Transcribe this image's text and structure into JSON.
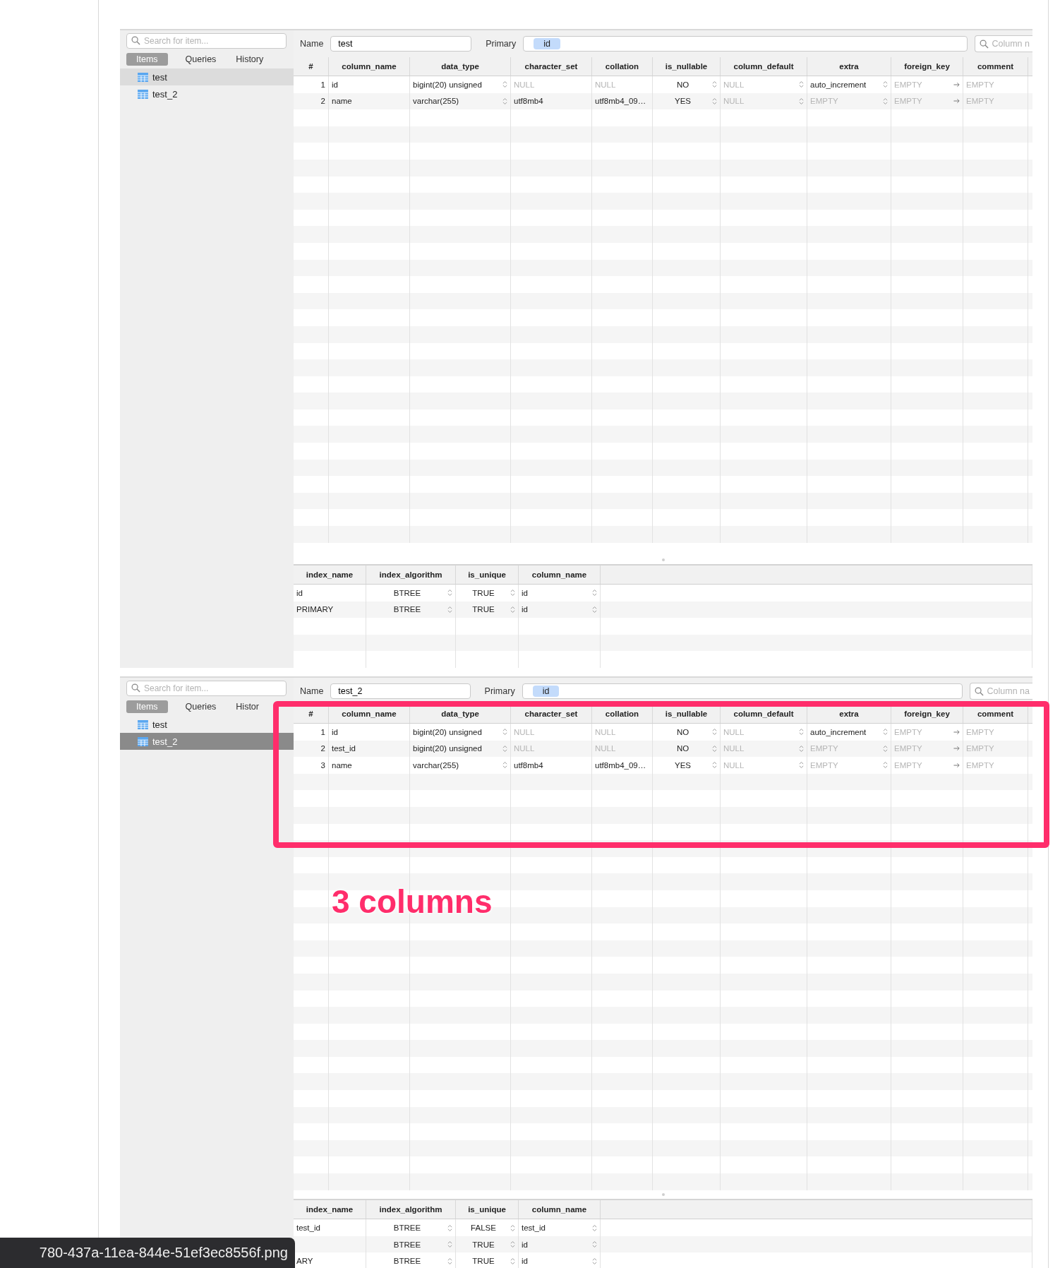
{
  "panels": [
    {
      "active": false,
      "search": {
        "placeholder": "Search for item..."
      },
      "tabs": [
        {
          "label": "Items",
          "selected": true
        },
        {
          "label": "Queries",
          "selected": false
        },
        {
          "label": "History",
          "selected": false
        }
      ],
      "items": [
        {
          "label": "test",
          "selected": true
        },
        {
          "label": "test_2",
          "selected": false
        }
      ],
      "name_label": "Name",
      "name_value": "test",
      "primary_label": "Primary",
      "primary_keys": [
        "id"
      ],
      "column_search": {
        "placeholder": "Column n"
      },
      "columns": [
        {
          "label": "#",
          "kind": "index"
        },
        {
          "label": "column_name",
          "kind": "text"
        },
        {
          "label": "data_type",
          "kind": "select"
        },
        {
          "label": "character_set",
          "kind": "text"
        },
        {
          "label": "collation",
          "kind": "text"
        },
        {
          "label": "is_nullable",
          "kind": "centered-select"
        },
        {
          "label": "column_default",
          "kind": "select"
        },
        {
          "label": "extra",
          "kind": "select"
        },
        {
          "label": "foreign_key",
          "kind": "reference"
        },
        {
          "label": "comment",
          "kind": "text"
        }
      ],
      "rows": [
        {
          "cells": [
            {
              "text": "1",
              "muted": false
            },
            {
              "text": "id",
              "muted": false
            },
            {
              "text": "bigint(20) unsigned",
              "muted": false
            },
            {
              "text": "NULL",
              "muted": true
            },
            {
              "text": "NULL",
              "muted": true
            },
            {
              "text": "NO",
              "muted": false
            },
            {
              "text": "NULL",
              "muted": true
            },
            {
              "text": "auto_increment",
              "muted": false
            },
            {
              "text": "EMPTY",
              "muted": true
            },
            {
              "text": "EMPTY",
              "muted": true
            }
          ]
        },
        {
          "cells": [
            {
              "text": "2",
              "muted": false
            },
            {
              "text": "name",
              "muted": false
            },
            {
              "text": "varchar(255)",
              "muted": false
            },
            {
              "text": "utf8mb4",
              "muted": false
            },
            {
              "text": "utf8mb4_09…",
              "muted": false
            },
            {
              "text": "YES",
              "muted": false
            },
            {
              "text": "NULL",
              "muted": true
            },
            {
              "text": "EMPTY",
              "muted": true
            },
            {
              "text": "EMPTY",
              "muted": true
            },
            {
              "text": "EMPTY",
              "muted": true
            }
          ]
        }
      ],
      "index_columns": [
        {
          "label": "index_name",
          "kind": "text"
        },
        {
          "label": "index_algorithm",
          "kind": "centered-select"
        },
        {
          "label": "is_unique",
          "kind": "centered-select"
        },
        {
          "label": "column_name",
          "kind": "select"
        }
      ],
      "index_rows": [
        {
          "cells": [
            {
              "text": "id",
              "muted": false
            },
            {
              "text": "BTREE",
              "muted": false
            },
            {
              "text": "TRUE",
              "muted": false
            },
            {
              "text": "id",
              "muted": false
            }
          ]
        },
        {
          "cells": [
            {
              "text": "PRIMARY",
              "muted": false
            },
            {
              "text": "BTREE",
              "muted": false
            },
            {
              "text": "TRUE",
              "muted": false
            },
            {
              "text": "id",
              "muted": false
            }
          ]
        }
      ]
    },
    {
      "active": true,
      "search": {
        "placeholder": "Search for item..."
      },
      "tabs": [
        {
          "label": "Items",
          "selected": true
        },
        {
          "label": "Queries",
          "selected": false
        },
        {
          "label": "Histor",
          "selected": false
        }
      ],
      "items": [
        {
          "label": "test",
          "selected": false
        },
        {
          "label": "test_2",
          "selected": true
        }
      ],
      "name_label": "Name",
      "name_value": "test_2",
      "primary_label": "Primary",
      "primary_keys": [
        "id"
      ],
      "column_search": {
        "placeholder": "Column na"
      },
      "columns": [
        {
          "label": "#",
          "kind": "index"
        },
        {
          "label": "column_name",
          "kind": "text"
        },
        {
          "label": "data_type",
          "kind": "select"
        },
        {
          "label": "character_set",
          "kind": "text"
        },
        {
          "label": "collation",
          "kind": "text"
        },
        {
          "label": "is_nullable",
          "kind": "centered-select"
        },
        {
          "label": "column_default",
          "kind": "select"
        },
        {
          "label": "extra",
          "kind": "select"
        },
        {
          "label": "foreign_key",
          "kind": "reference"
        },
        {
          "label": "comment",
          "kind": "text"
        }
      ],
      "rows": [
        {
          "cells": [
            {
              "text": "1",
              "muted": false
            },
            {
              "text": "id",
              "muted": false
            },
            {
              "text": "bigint(20) unsigned",
              "muted": false
            },
            {
              "text": "NULL",
              "muted": true
            },
            {
              "text": "NULL",
              "muted": true
            },
            {
              "text": "NO",
              "muted": false
            },
            {
              "text": "NULL",
              "muted": true
            },
            {
              "text": "auto_increment",
              "muted": false
            },
            {
              "text": "EMPTY",
              "muted": true
            },
            {
              "text": "EMPTY",
              "muted": true
            }
          ]
        },
        {
          "cells": [
            {
              "text": "2",
              "muted": false
            },
            {
              "text": "test_id",
              "muted": false
            },
            {
              "text": "bigint(20) unsigned",
              "muted": false
            },
            {
              "text": "NULL",
              "muted": true
            },
            {
              "text": "NULL",
              "muted": true
            },
            {
              "text": "NO",
              "muted": false
            },
            {
              "text": "NULL",
              "muted": true
            },
            {
              "text": "EMPTY",
              "muted": true
            },
            {
              "text": "EMPTY",
              "muted": true
            },
            {
              "text": "EMPTY",
              "muted": true
            }
          ]
        },
        {
          "cells": [
            {
              "text": "3",
              "muted": false
            },
            {
              "text": "name",
              "muted": false
            },
            {
              "text": "varchar(255)",
              "muted": false
            },
            {
              "text": "utf8mb4",
              "muted": false
            },
            {
              "text": "utf8mb4_09…",
              "muted": false
            },
            {
              "text": "YES",
              "muted": false
            },
            {
              "text": "NULL",
              "muted": true
            },
            {
              "text": "EMPTY",
              "muted": true
            },
            {
              "text": "EMPTY",
              "muted": true
            },
            {
              "text": "EMPTY",
              "muted": true
            }
          ]
        }
      ],
      "index_columns": [
        {
          "label": "index_name",
          "kind": "text"
        },
        {
          "label": "index_algorithm",
          "kind": "centered-select"
        },
        {
          "label": "is_unique",
          "kind": "centered-select"
        },
        {
          "label": "column_name",
          "kind": "select"
        }
      ],
      "index_rows": [
        {
          "cells": [
            {
              "text": "test_id",
              "muted": false
            },
            {
              "text": "BTREE",
              "muted": false
            },
            {
              "text": "FALSE",
              "muted": false
            },
            {
              "text": "test_id",
              "muted": false
            }
          ]
        },
        {
          "cells": [
            null,
            {
              "text": "BTREE",
              "muted": false
            },
            {
              "text": "TRUE",
              "muted": false
            },
            {
              "text": "id",
              "muted": false
            }
          ]
        },
        {
          "cells": [
            {
              "text": "ARY",
              "muted": false
            },
            {
              "text": "BTREE",
              "muted": false
            },
            {
              "text": "TRUE",
              "muted": false
            },
            {
              "text": "id",
              "muted": false
            }
          ]
        }
      ]
    }
  ],
  "annotation": {
    "label": "3 columns"
  },
  "file_tooltip": "780-437a-11ea-844e-51ef3ec8556f.png"
}
